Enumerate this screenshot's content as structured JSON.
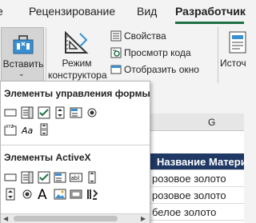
{
  "tabs": {
    "review": "Рецензирование",
    "view": "Вид",
    "developer": "Разработчик"
  },
  "ribbon": {
    "insert_label": "Вставить",
    "design_mode_label": "Режим конструктора",
    "properties_label": "Свойства",
    "view_code_label": "Просмотр кода",
    "run_dialog_label": "Отобразить окно",
    "source_label": "Источ"
  },
  "dropdown": {
    "form_controls_title": "Элементы управления формы",
    "activex_title": "Элементы ActiveX"
  },
  "sheet": {
    "column_letter": "G",
    "header_text": "Название Матери",
    "rows": [
      "розовое золото",
      "розовое золото",
      "белое золото"
    ]
  },
  "colors": {
    "accent": "#1e7145",
    "header_fill": "#1f3864"
  }
}
